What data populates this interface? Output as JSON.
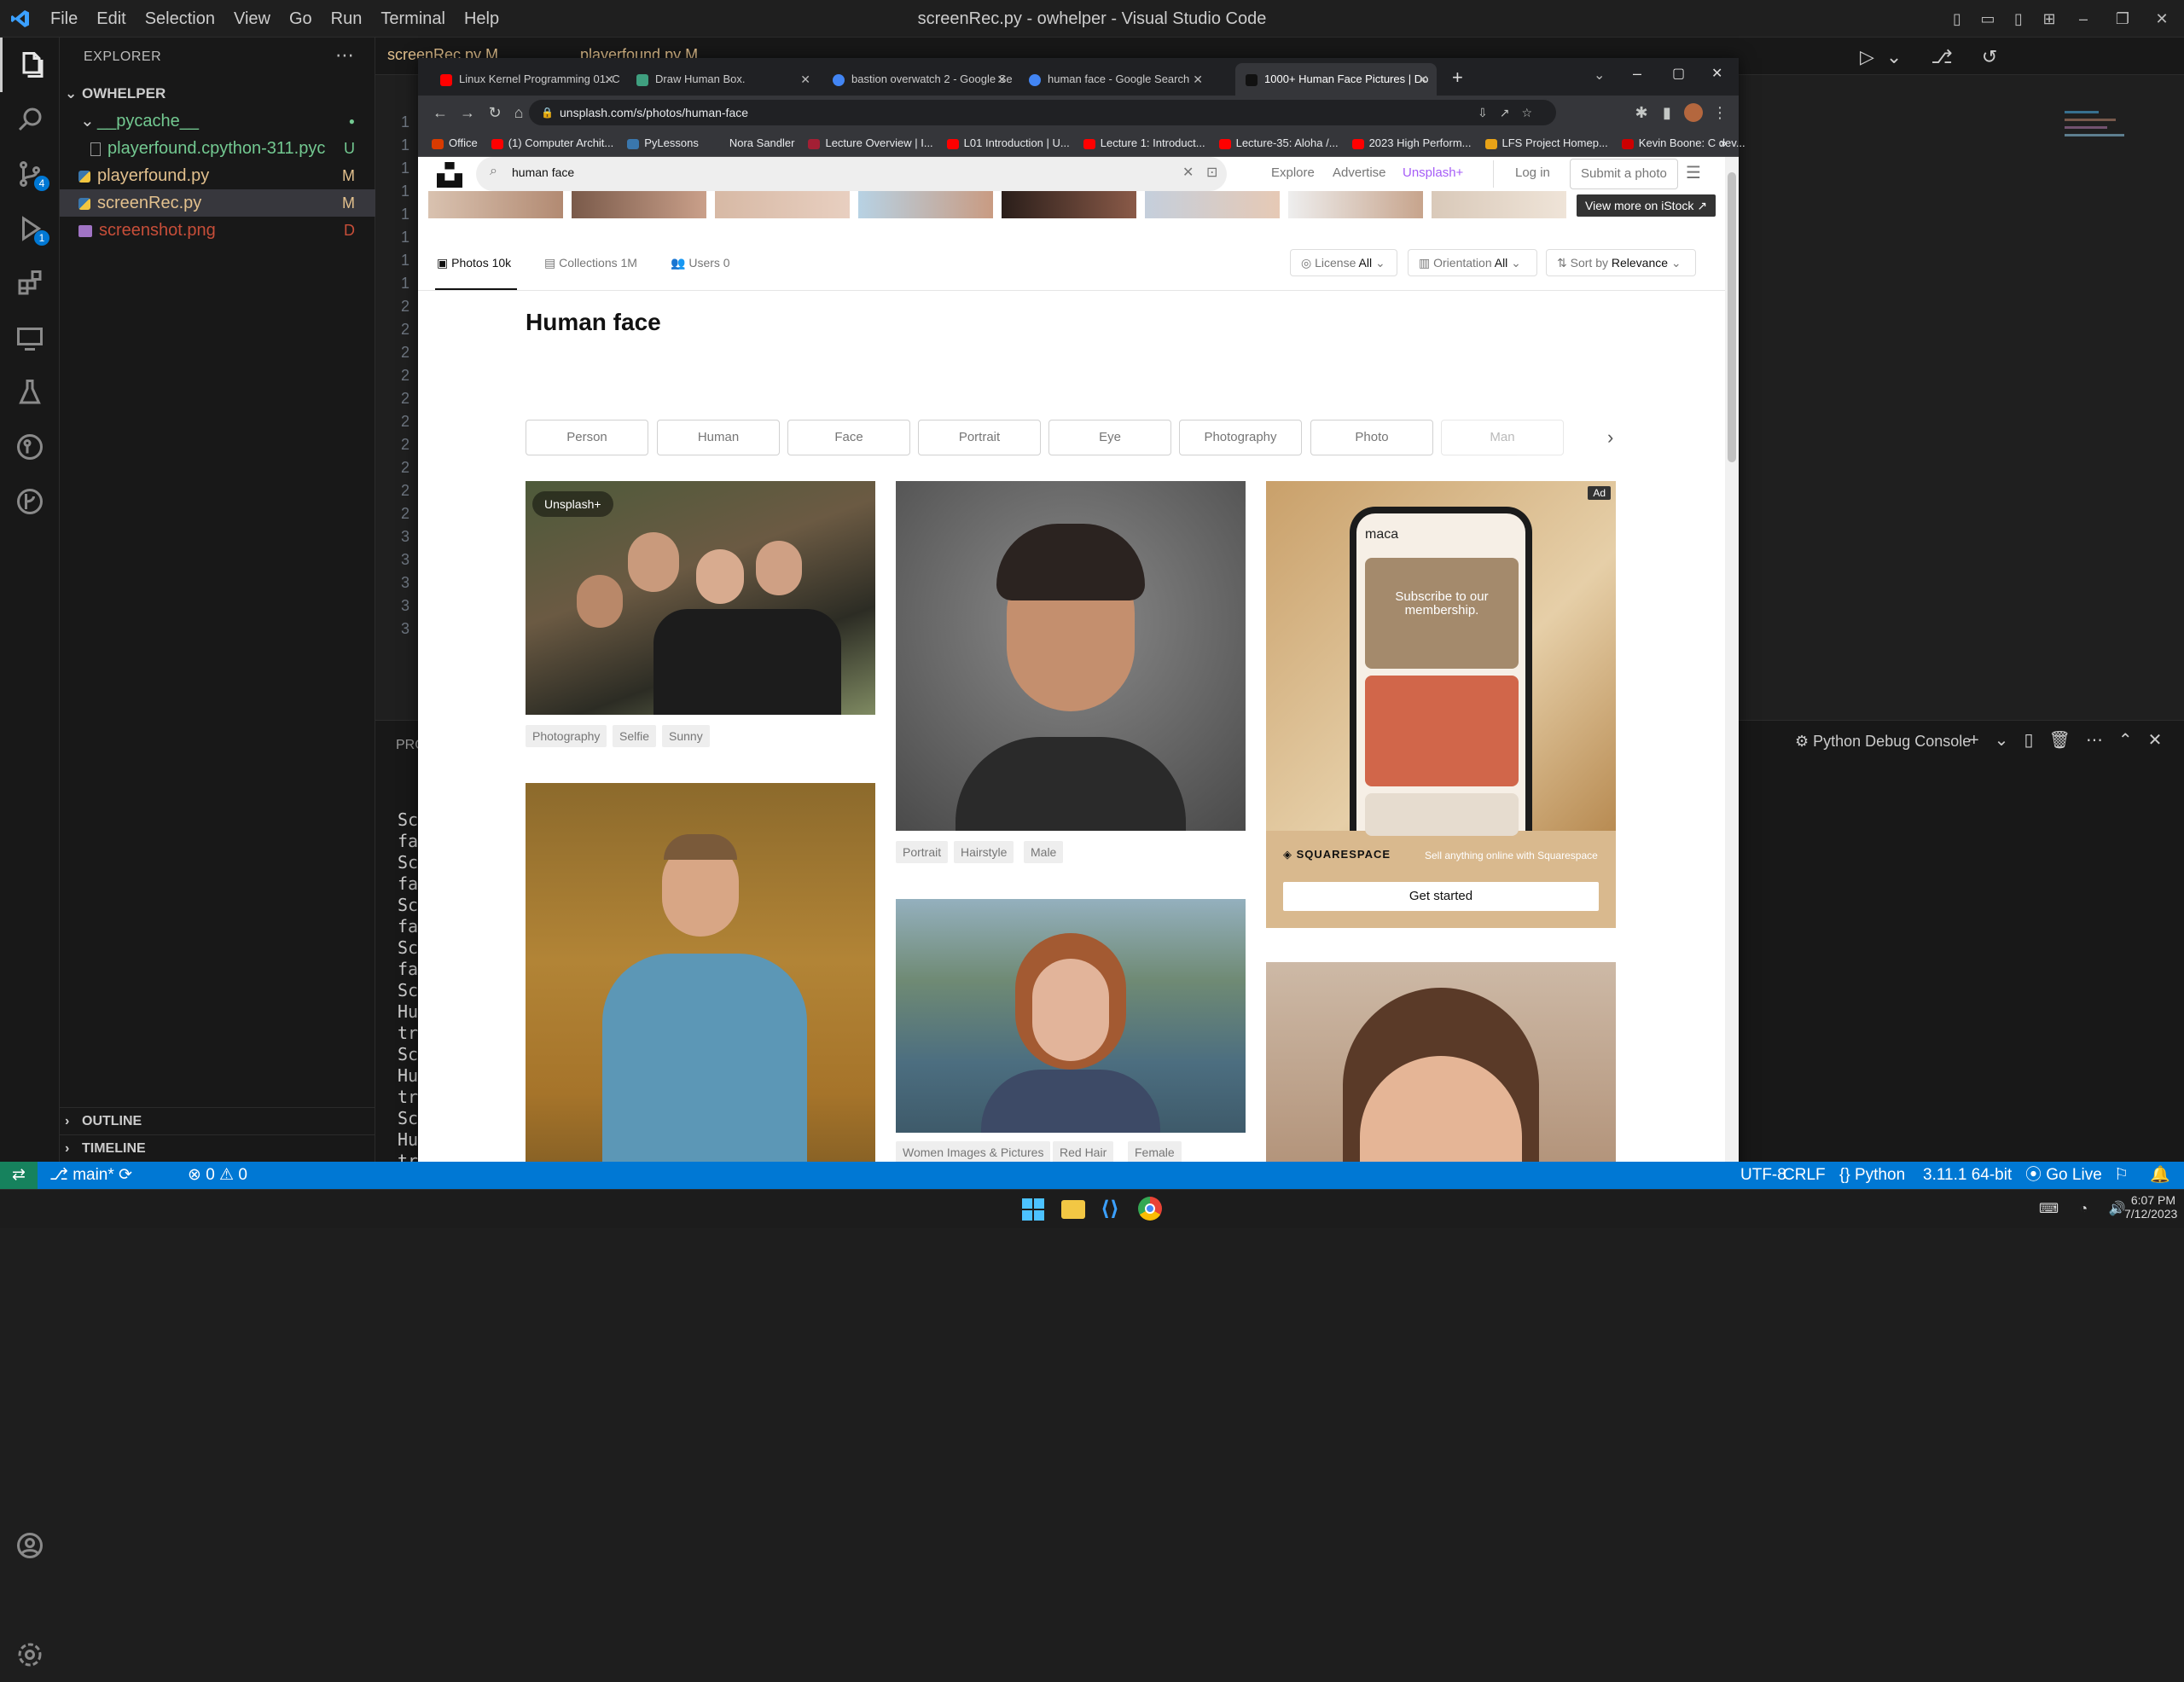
{
  "vscode": {
    "window_title": "screenRec.py - owhelper - Visual Studio Code",
    "menu": [
      "File",
      "Edit",
      "Selection",
      "View",
      "Go",
      "Run",
      "Terminal",
      "Help"
    ],
    "explorer": {
      "title": "EXPLORER",
      "root": "OWHELPER",
      "items": [
        {
          "label": "__pycache__",
          "status": "●",
          "color": "#73c991"
        },
        {
          "label": "playerfound.cpython-311.pyc",
          "status": "U",
          "color": "#73c991"
        },
        {
          "label": "playerfound.py",
          "status": "M",
          "color": "#e2c08d"
        },
        {
          "label": "screenRec.py",
          "status": "M",
          "color": "#e2c08d"
        },
        {
          "label": "screenshot.png",
          "status": "D",
          "color": "#c74e39"
        }
      ],
      "outline": "OUTLINE",
      "timeline": "TIMELINE"
    },
    "activity_badges": {
      "source_control": "4",
      "run_debug": "1"
    },
    "editor_tabs": [
      "screenRec.py M",
      "playerfound.py M"
    ],
    "line_numbers": [
      "1",
      "1",
      "1",
      "1",
      "1",
      "1",
      "1",
      "1",
      "2",
      "2",
      "2",
      "2",
      "2",
      "2",
      "2",
      "2",
      "2",
      "2",
      "3",
      "3",
      "3",
      "3",
      "3"
    ],
    "panel": {
      "label": "PRO",
      "debug_console": "Python Debug Console",
      "lines": [
        "Sc",
        "fa",
        "Sc",
        "fa",
        "Sc",
        "fa",
        "Sc",
        "fa",
        "Sc",
        "Hu",
        "tr",
        "Sc",
        "Hu",
        "tr",
        "Sc",
        "Hu",
        "tr"
      ]
    },
    "status": {
      "branch": "main*",
      "errors": "0",
      "warnings": "0",
      "encoding": "UTF-8",
      "eol": "CRLF",
      "language": "Python",
      "interpreter": "3.11.1 64-bit",
      "golive": "Go Live"
    }
  },
  "chrome": {
    "tabs": [
      {
        "label": "Linux Kernel Programming 01: C",
        "color": "#ff0000"
      },
      {
        "label": "Draw Human Box.",
        "color": "#3f9f7f"
      },
      {
        "label": "bastion overwatch 2 - Google Se",
        "color": "#4285f4"
      },
      {
        "label": "human face - Google Search",
        "color": "#4285f4"
      },
      {
        "label": "1000+ Human Face Pictures | Do",
        "color": "#111111"
      }
    ],
    "url": "unsplash.com/s/photos/human-face",
    "bookmarks": [
      {
        "label": "Office",
        "color": "#d83b01"
      },
      {
        "label": "(1) Computer Archit...",
        "color": "#ff0000"
      },
      {
        "label": "PyLessons",
        "color": "#3a77ad"
      },
      {
        "label": "Nora Sandler",
        "color": "#35363a"
      },
      {
        "label": "Lecture Overview | I...",
        "color": "#a31f34"
      },
      {
        "label": "L01 Introduction | U...",
        "color": "#ff0000"
      },
      {
        "label": "Lecture 1: Introduct...",
        "color": "#ff0000"
      },
      {
        "label": "Lecture-35: Aloha /...",
        "color": "#ff0000"
      },
      {
        "label": "2023 High Perform...",
        "color": "#ff0000"
      },
      {
        "label": "LFS Project Homep...",
        "color": "#e8a317"
      },
      {
        "label": "Kevin Boone: C dev...",
        "color": "#cc0000"
      }
    ]
  },
  "unsplash": {
    "search_value": "human face",
    "nav": {
      "explore": "Explore",
      "advertise": "Advertise",
      "plus": "Unsplash+",
      "login": "Log in",
      "submit": "Submit a photo"
    },
    "istock": "View more on iStock ↗",
    "tabs": {
      "photos": "Photos 10k",
      "collections": "Collections 1M",
      "users": "Users 0"
    },
    "filters": {
      "license_label": "License",
      "license_value": "All",
      "orientation_label": "Orientation",
      "orientation_value": "All",
      "sort_label": "Sort by",
      "sort_value": "Relevance"
    },
    "heading": "Human face",
    "chips": [
      "Person",
      "Human",
      "Face",
      "Portrait",
      "Eye",
      "Photography",
      "Photo",
      "Man"
    ],
    "badge_plus": "Unsplash+",
    "tags1": [
      "Photography",
      "Selfie",
      "Sunny"
    ],
    "tags2": [
      "Portrait",
      "Hairstyle",
      "Male"
    ],
    "tags3": [
      "Women Images & Pictures",
      "Red Hair",
      "Female"
    ],
    "ad": {
      "label": "Ad",
      "brand": "maca",
      "headline": "Subscribe to our membership.",
      "sponsor": "SQUARESPACE",
      "tagline": "Sell anything online with Squarespace",
      "cta": "Get started"
    }
  },
  "taskbar": {
    "time": "6:07 PM",
    "date": "7/12/2023"
  }
}
